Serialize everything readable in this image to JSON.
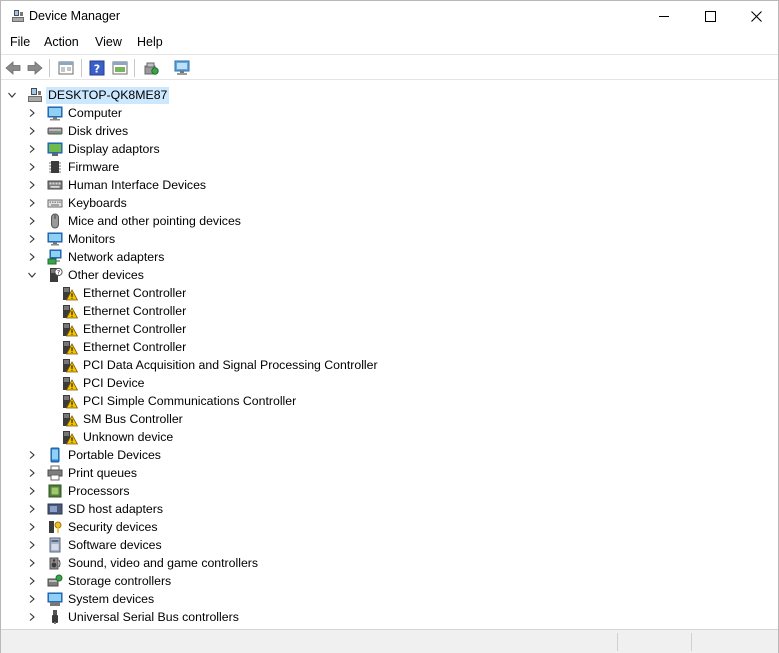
{
  "window": {
    "title": "Device Manager"
  },
  "menu": {
    "items": [
      "File",
      "Action",
      "View",
      "Help"
    ]
  },
  "toolbar": {
    "buttons": [
      "back-arrow-icon",
      "forward-arrow-icon",
      "properties-pane-icon",
      "help-icon",
      "view-console-icon",
      "update-driver-icon",
      "scan-hardware-icon"
    ]
  },
  "tree": {
    "root": "DESKTOP-QK8ME87",
    "categories": [
      {
        "label": "Computer",
        "icon": "computer-icon"
      },
      {
        "label": "Disk drives",
        "icon": "disk-drive-icon"
      },
      {
        "label": "Display adaptors",
        "icon": "display-adapter-icon"
      },
      {
        "label": "Firmware",
        "icon": "firmware-chip-icon"
      },
      {
        "label": "Human Interface Devices",
        "icon": "hid-icon"
      },
      {
        "label": "Keyboards",
        "icon": "keyboard-icon"
      },
      {
        "label": "Mice and other pointing devices",
        "icon": "mouse-icon"
      },
      {
        "label": "Monitors",
        "icon": "monitor-icon"
      },
      {
        "label": "Network adapters",
        "icon": "network-adapter-icon"
      },
      {
        "label": "Other devices",
        "icon": "other-devices-icon",
        "expanded": true,
        "children": [
          "Ethernet Controller",
          "Ethernet Controller",
          "Ethernet Controller",
          "Ethernet Controller",
          "PCI Data Acquisition and Signal Processing Controller",
          "PCI Device",
          "PCI Simple Communications Controller",
          "SM Bus Controller",
          "Unknown device"
        ]
      },
      {
        "label": "Portable Devices",
        "icon": "portable-device-icon"
      },
      {
        "label": "Print queues",
        "icon": "printer-icon"
      },
      {
        "label": "Processors",
        "icon": "processor-icon"
      },
      {
        "label": "SD host adapters",
        "icon": "sd-card-icon"
      },
      {
        "label": "Security devices",
        "icon": "security-key-icon"
      },
      {
        "label": "Software devices",
        "icon": "software-device-icon"
      },
      {
        "label": "Sound, video and game controllers",
        "icon": "speaker-icon"
      },
      {
        "label": "Storage controllers",
        "icon": "storage-controller-icon"
      },
      {
        "label": "System devices",
        "icon": "system-device-icon"
      },
      {
        "label": "Universal Serial Bus controllers",
        "icon": "usb-icon"
      }
    ]
  },
  "colors": {
    "selection": "#cce8ff",
    "warning": "#f5c400",
    "accent": "#1e6fd9"
  }
}
